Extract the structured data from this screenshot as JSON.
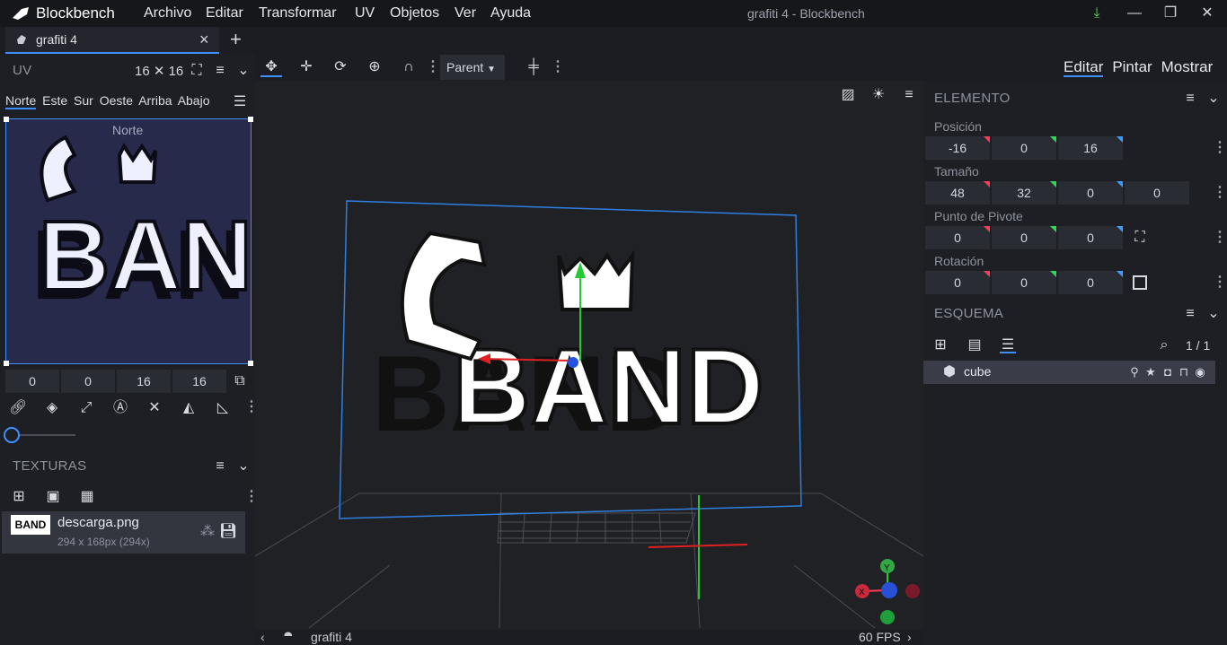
{
  "app": {
    "name": "Blockbench",
    "window_title": "grafiti 4 - Blockbench"
  },
  "menu": [
    "Archivo",
    "Editar",
    "Transformar",
    "UV",
    "Objetos",
    "Ver",
    "Ayuda"
  ],
  "tab": {
    "title": "grafiti 4",
    "close": "×",
    "new": "+"
  },
  "uv_panel": {
    "title": "UV",
    "size": "16 ✕ 16",
    "faces": [
      "Norte",
      "Este",
      "Sur",
      "Oeste",
      "Arriba",
      "Abajo"
    ],
    "active_face": "Norte",
    "face_label": "Norte",
    "coords": [
      "0",
      "0",
      "16",
      "16"
    ]
  },
  "textures_panel": {
    "title": "TEXTURAS",
    "texture": {
      "name": "descarga.png",
      "info": "294 x 168px (294x)"
    }
  },
  "toolbar": {
    "parent_select": "Parent"
  },
  "modes": [
    "Editar",
    "Pintar",
    "Mostrar"
  ],
  "active_mode": "Editar",
  "element_panel": {
    "title": "ELEMENTO",
    "position_label": "Posición",
    "position": [
      "-16",
      "0",
      "16"
    ],
    "size_label": "Tamaño",
    "size": [
      "48",
      "32",
      "0",
      "0"
    ],
    "pivot_label": "Punto de Pivote",
    "pivot": [
      "0",
      "0",
      "0"
    ],
    "rotation_label": "Rotación",
    "rotation": [
      "0",
      "0",
      "0"
    ]
  },
  "outliner": {
    "title": "ESQUEMA",
    "count": "1 / 1",
    "item": "cube"
  },
  "status": {
    "project": "grafiti 4",
    "fps": "60 FPS"
  },
  "texture_art": {
    "text": "BAND"
  },
  "colors": {
    "accent": "#3e90ff",
    "axis_x": "#ff3b5c",
    "axis_y": "#31d85e",
    "axis_z": "#3a6dff"
  }
}
